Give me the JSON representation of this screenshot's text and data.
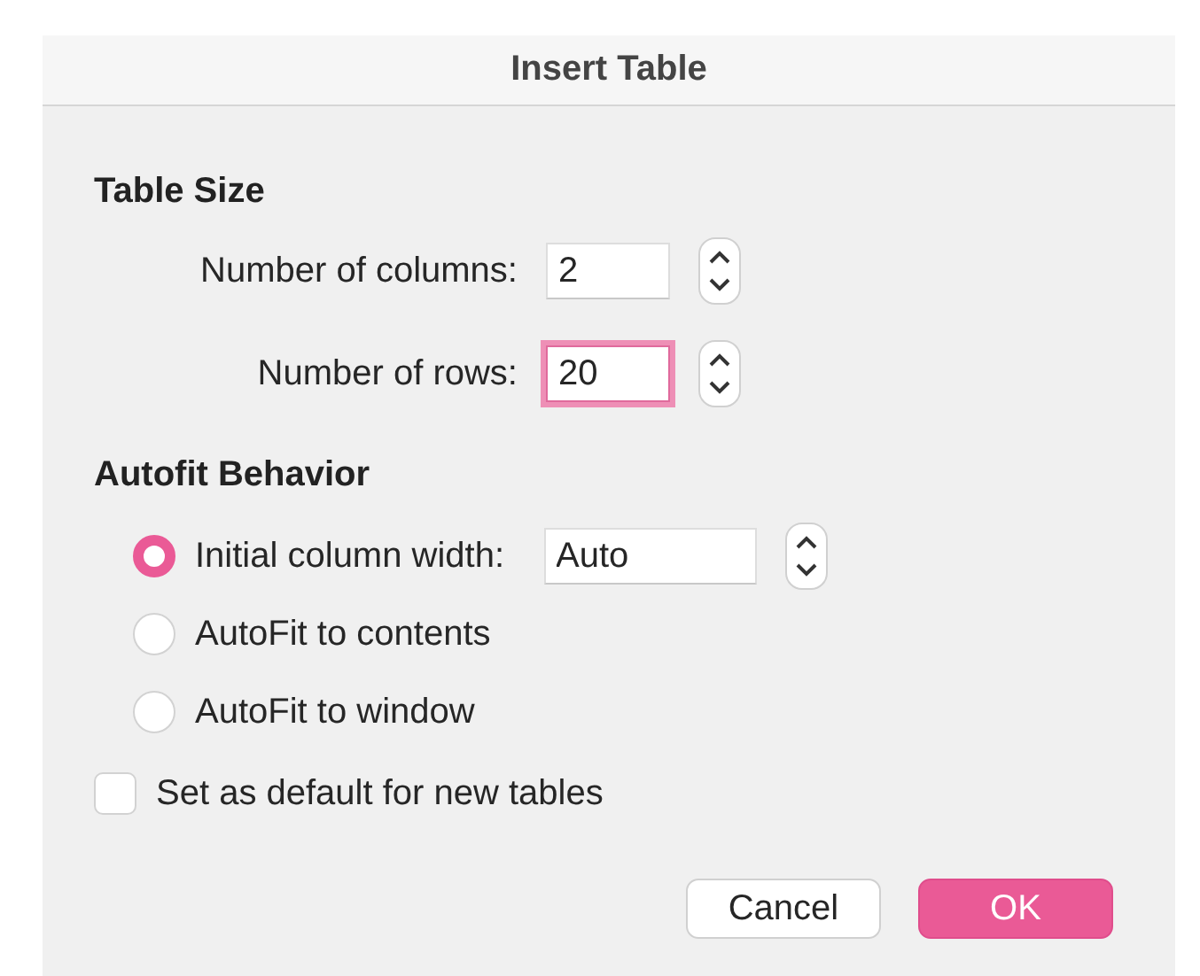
{
  "window": {
    "title": "Insert Table"
  },
  "table_size": {
    "heading": "Table Size",
    "fields": [
      {
        "label": "Number of columns:",
        "value": "2",
        "focused": false
      },
      {
        "label": "Number of rows:",
        "value": "20",
        "focused": true
      }
    ]
  },
  "autofit": {
    "heading": "Autofit Behavior",
    "options": [
      {
        "label": "Initial column width:",
        "selected": true,
        "field": {
          "value": "Auto"
        }
      },
      {
        "label": "AutoFit to contents",
        "selected": false
      },
      {
        "label": "AutoFit to window",
        "selected": false
      }
    ]
  },
  "default_checkbox": {
    "label": "Set as default for new tables",
    "checked": false
  },
  "buttons": [
    {
      "label": "Cancel",
      "kind": "secondary"
    },
    {
      "label": "OK",
      "kind": "primary"
    }
  ]
}
